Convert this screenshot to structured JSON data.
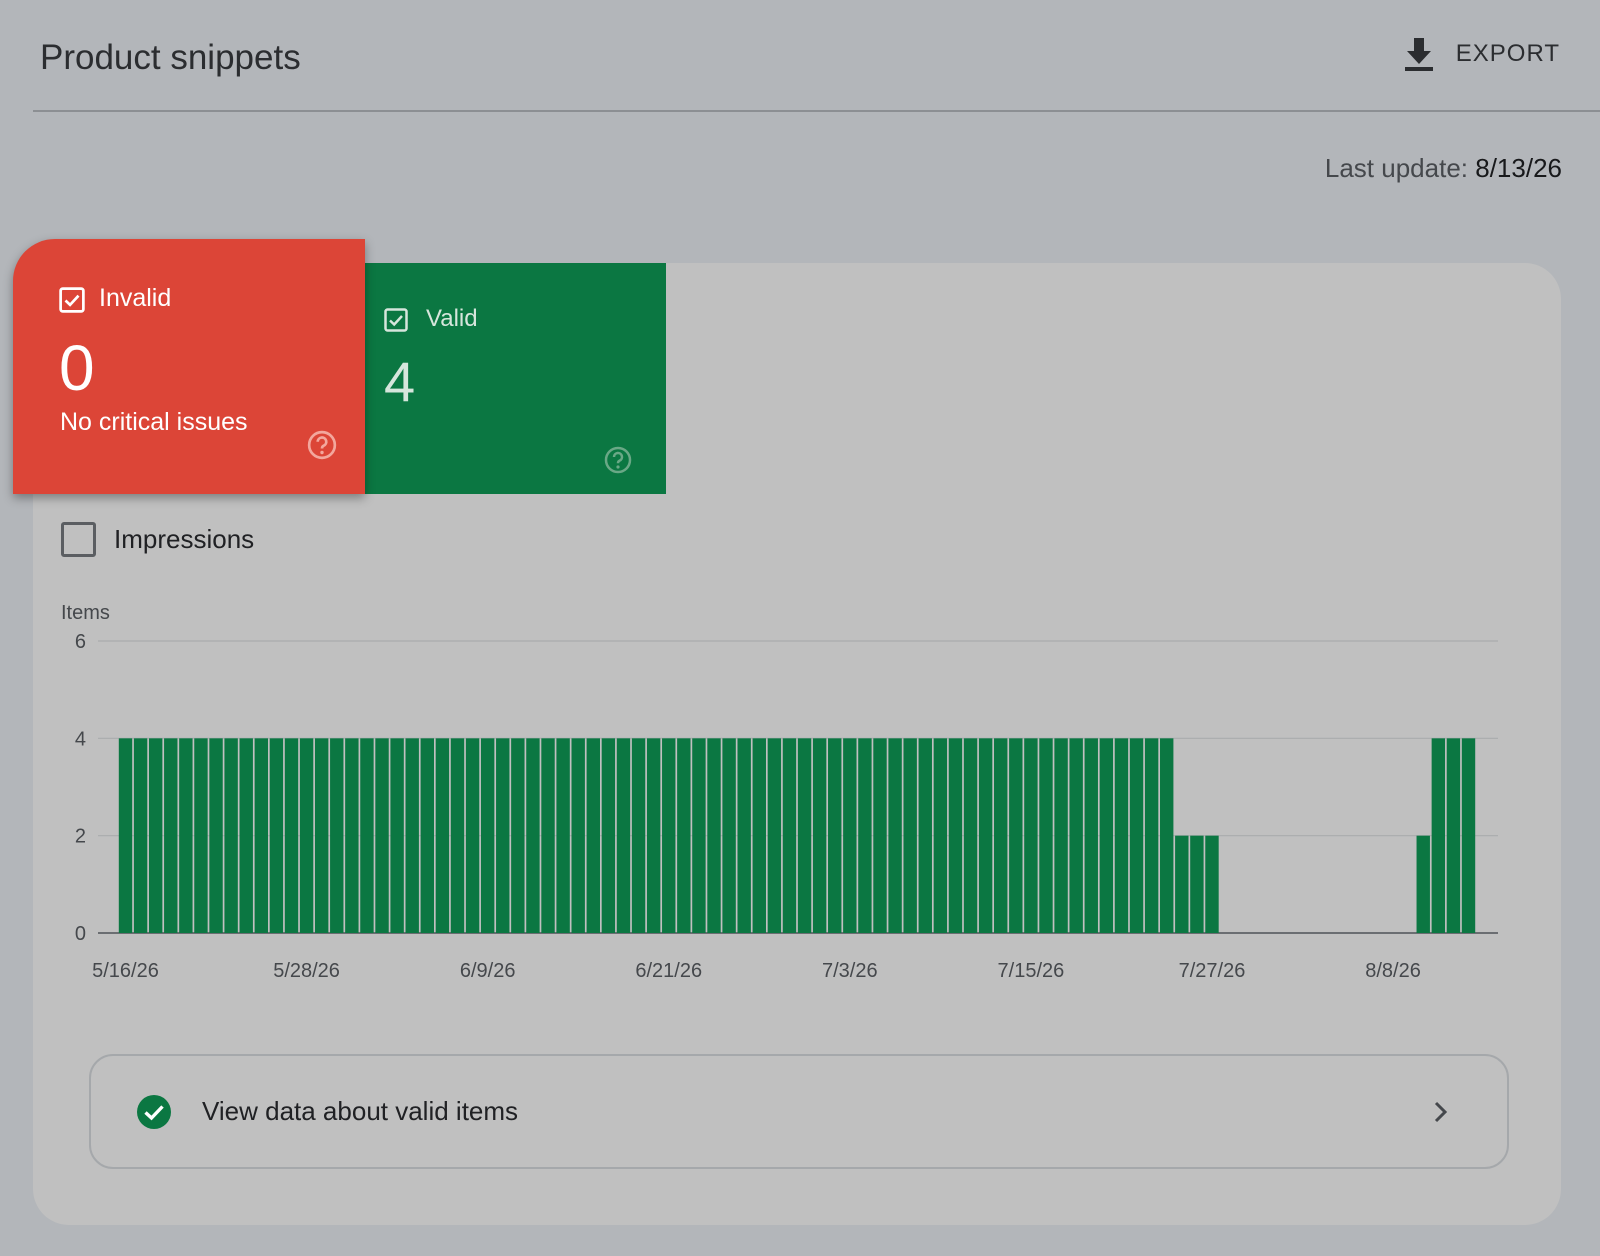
{
  "header": {
    "title": "Product snippets",
    "export_label": "EXPORT",
    "last_update_label": "Last update:",
    "last_update_value": "8/13/26"
  },
  "tiles": {
    "invalid": {
      "label": "Invalid",
      "count": "0",
      "subtitle": "No critical issues",
      "checked": true,
      "color": "#dc4537"
    },
    "valid": {
      "label": "Valid",
      "count": "4",
      "checked": true,
      "color": "#0b7742"
    }
  },
  "impressions": {
    "label": "Impressions",
    "checked": false
  },
  "view_data": {
    "label": "View data about valid items"
  },
  "icons": {
    "export": "download-icon",
    "tile_checkbox": "checkbox-checked-icon",
    "help": "help-circle-icon",
    "valid_status": "check-circle-icon",
    "chevron": "chevron-right-icon"
  },
  "chart_data": {
    "type": "bar",
    "title": "",
    "ylabel": "Items",
    "xlabel": "",
    "ylim": [
      0,
      6
    ],
    "yticks": [
      0,
      2,
      4,
      6
    ],
    "xtick_labels": [
      "5/16/26",
      "5/28/26",
      "6/9/26",
      "6/21/26",
      "7/3/26",
      "7/15/26",
      "7/27/26",
      "8/8/26"
    ],
    "grid": true,
    "bar_color": "#0b7742",
    "series": [
      {
        "x": [
          "5/16/26",
          "5/17/26",
          "5/18/26",
          "5/19/26",
          "5/20/26",
          "5/21/26",
          "5/22/26",
          "5/23/26",
          "5/24/26",
          "5/25/26",
          "5/26/26",
          "5/27/26",
          "5/28/26",
          "5/29/26",
          "5/30/26",
          "5/31/26",
          "6/1/26",
          "6/2/26",
          "6/3/26",
          "6/4/26",
          "6/5/26",
          "6/6/26",
          "6/7/26",
          "6/8/26",
          "6/9/26",
          "6/10/26",
          "6/11/26",
          "6/12/26",
          "6/13/26",
          "6/14/26",
          "6/15/26",
          "6/16/26",
          "6/17/26",
          "6/18/26",
          "6/19/26",
          "6/20/26",
          "6/21/26",
          "6/22/26",
          "6/23/26",
          "6/24/26",
          "6/25/26",
          "6/26/26",
          "6/27/26",
          "6/28/26",
          "6/29/26",
          "6/30/26",
          "7/1/26",
          "7/2/26",
          "7/3/26",
          "7/4/26",
          "7/5/26",
          "7/6/26",
          "7/7/26",
          "7/8/26",
          "7/9/26",
          "7/10/26",
          "7/11/26",
          "7/12/26",
          "7/13/26",
          "7/14/26",
          "7/15/26",
          "7/16/26",
          "7/17/26",
          "7/18/26",
          "7/19/26",
          "7/20/26",
          "7/21/26",
          "7/22/26",
          "7/23/26",
          "7/24/26",
          "7/25/26",
          "7/26/26",
          "7/27/26",
          "7/28/26",
          "7/29/26",
          "7/30/26",
          "7/31/26",
          "8/1/26",
          "8/2/26",
          "8/3/26",
          "8/4/26",
          "8/5/26",
          "8/6/26",
          "8/7/26",
          "8/8/26",
          "8/9/26",
          "8/10/26",
          "8/11/26",
          "8/12/26",
          "8/13/26"
        ],
        "values": [
          4,
          4,
          4,
          4,
          4,
          4,
          4,
          4,
          4,
          4,
          4,
          4,
          4,
          4,
          4,
          4,
          4,
          4,
          4,
          4,
          4,
          4,
          4,
          4,
          4,
          4,
          4,
          4,
          4,
          4,
          4,
          4,
          4,
          4,
          4,
          4,
          4,
          4,
          4,
          4,
          4,
          4,
          4,
          4,
          4,
          4,
          4,
          4,
          4,
          4,
          4,
          4,
          4,
          4,
          4,
          4,
          4,
          4,
          4,
          4,
          4,
          4,
          4,
          4,
          4,
          4,
          4,
          4,
          4,
          4,
          2,
          2,
          2,
          0,
          0,
          0,
          0,
          0,
          0,
          0,
          0,
          0,
          0,
          0,
          0,
          0,
          2,
          4,
          4,
          4
        ]
      }
    ]
  }
}
